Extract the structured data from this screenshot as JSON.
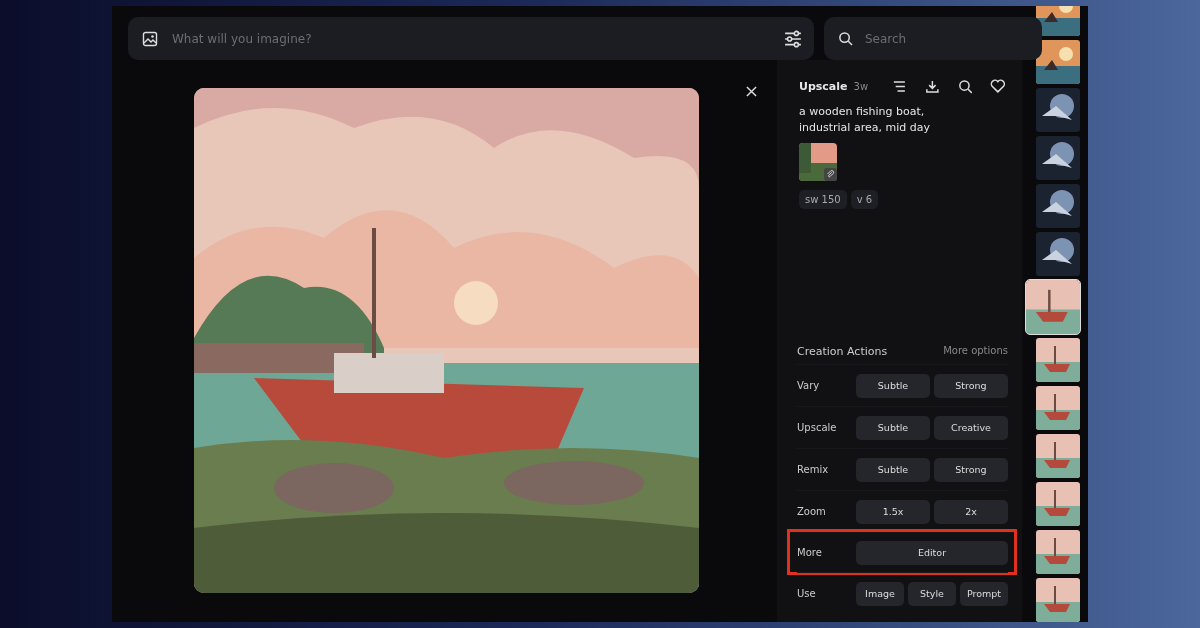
{
  "prompt_bar": {
    "placeholder": "What will you imagine?"
  },
  "search": {
    "placeholder": "Search"
  },
  "details": {
    "title": "Upscale",
    "age": "3w",
    "prompt": "a wooden fishing boat, industrial area, mid day",
    "tags": [
      "sw 150",
      "v 6"
    ]
  },
  "actions": {
    "heading": "Creation Actions",
    "more_link": "More options",
    "rows": [
      {
        "label": "Vary",
        "buttons": [
          "Subtle",
          "Strong"
        ],
        "highlighted": false
      },
      {
        "label": "Upscale",
        "buttons": [
          "Subtle",
          "Creative"
        ],
        "highlighted": false
      },
      {
        "label": "Remix",
        "buttons": [
          "Subtle",
          "Strong"
        ],
        "highlighted": false
      },
      {
        "label": "Zoom",
        "buttons": [
          "1.5x",
          "2x"
        ],
        "highlighted": false
      },
      {
        "label": "More",
        "buttons": [
          "Editor"
        ],
        "highlighted": true
      },
      {
        "label": "Use",
        "buttons": [
          "Image",
          "Style",
          "Prompt"
        ],
        "highlighted": false
      }
    ]
  },
  "thumbnails": [
    {
      "selected": false
    },
    {
      "selected": false
    },
    {
      "selected": false
    },
    {
      "selected": false
    },
    {
      "selected": false
    },
    {
      "selected": false
    },
    {
      "selected": true
    },
    {
      "selected": false
    },
    {
      "selected": false
    },
    {
      "selected": false
    },
    {
      "selected": false
    },
    {
      "selected": false
    },
    {
      "selected": false
    }
  ]
}
